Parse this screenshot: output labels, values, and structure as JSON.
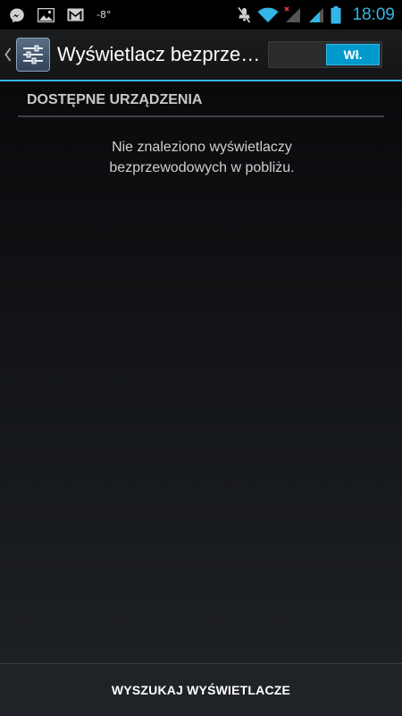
{
  "status_bar": {
    "temperature": "-8°",
    "time": "18:09",
    "left_icons": [
      "messenger-icon",
      "gallery-icon",
      "gmail-icon"
    ],
    "right_icons": [
      "mute-icon",
      "wifi-icon",
      "signal-no-service-icon",
      "signal-icon",
      "battery-icon"
    ],
    "accent_color": "#33b5e5"
  },
  "action_bar": {
    "title": "Wyświetlacz bezprze…",
    "switch_label": "Wł.",
    "switch_state": "on"
  },
  "section": {
    "header": "DOSTĘPNE URZĄDZENIA",
    "empty_message_line1": "Nie znaleziono wyświetlaczy",
    "empty_message_line2": "bezprzewodowych w pobliżu."
  },
  "bottom_bar": {
    "button_label": "WYSZUKAJ WYŚWIETLACZE"
  }
}
